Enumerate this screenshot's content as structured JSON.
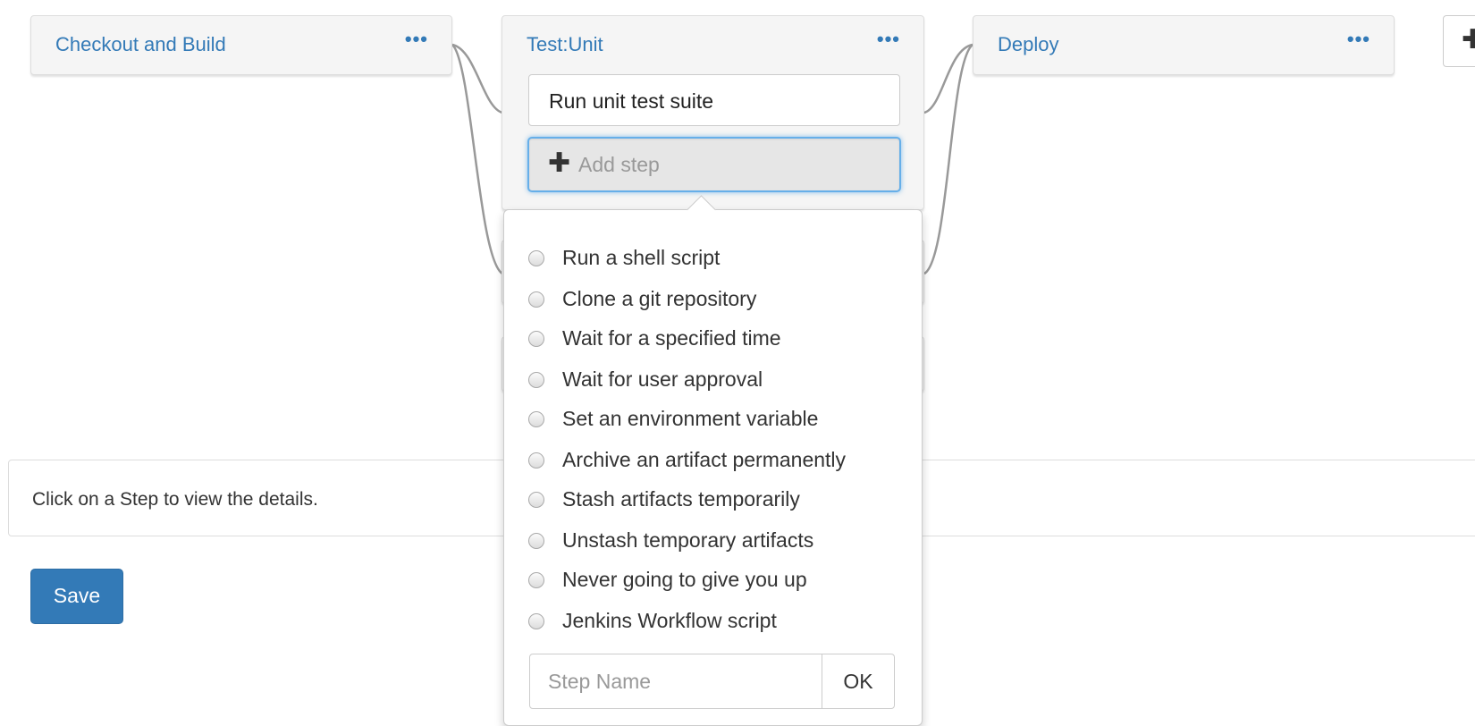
{
  "pipeline": {
    "stages": [
      {
        "title": "Checkout and Build",
        "menu": "•••"
      },
      {
        "title": "Test:Unit",
        "menu": "•••"
      },
      {
        "title": "Deploy",
        "menu": "•••"
      }
    ],
    "add_stage_icon": "plus-icon",
    "test_stage": {
      "steps": [
        "Run unit test suite"
      ],
      "add_step_label": "Add step"
    }
  },
  "step_popover": {
    "step_types": [
      "Run a shell script",
      "Clone a git repository",
      "Wait for a specified time",
      "Wait for user approval",
      "Set an environment variable",
      "Archive an artifact permanently",
      "Stash artifacts temporarily",
      "Unstash temporary artifacts",
      "Never going to give you up",
      "Jenkins Workflow script"
    ],
    "step_name_placeholder": "Step Name",
    "ok_label": "OK"
  },
  "details": {
    "message": "Click on a Step to view the details."
  },
  "save_label": "Save",
  "colors": {
    "link": "#337ab7",
    "primary_button": "#337ab7",
    "focus_ring": "#66afe9",
    "connector": "#999999"
  }
}
